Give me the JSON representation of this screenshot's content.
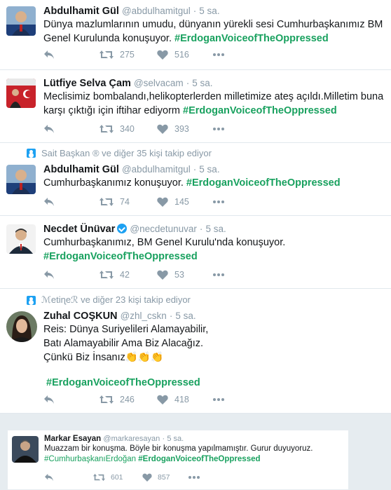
{
  "tweets": [
    {
      "name": "Abdulhamit Gül",
      "handle": "@abdulhamitgul",
      "sep": "·",
      "time": "5 sa.",
      "text": "Dünya mazlumlarının umudu, dünyanın yürekli sesi Cumhurbaşkanımız BM Genel Kurulunda konuşuyor.",
      "hashtag": "#ErdoganVoiceofTheOppressed",
      "retweets": "275",
      "likes": "516"
    },
    {
      "name": "Lütfiye Selva Çam",
      "handle": "@selvacam",
      "sep": "·",
      "time": "5 sa.",
      "text": "Meclisimiz bombalandı,helikopterlerden milletimize ateş açıldı.Milletim buna karşı çıktığı için iftihar ediyorm",
      "hashtag": "#ErdoganVoiceofTheOppressed",
      "retweets": "340",
      "likes": "393"
    },
    {
      "social": "Sait Başkan ® ve diğer 35 kişi takip ediyor",
      "name": "Abdulhamit Gül",
      "handle": "@abdulhamitgul",
      "sep": "·",
      "time": "5 sa.",
      "text": "Cumhurbaşkanımız konuşuyor.",
      "hashtag": "#ErdoganVoiceofTheOppressed",
      "retweets": "74",
      "likes": "145"
    },
    {
      "name": "Necdet Ünüvar",
      "handle": "@necdetunuvar",
      "sep": "·",
      "time": "5 sa.",
      "text": "Cumhurbaşkanımız, BM Genel Kurulu'nda konuşuyor.",
      "hashtag": "#ErdoganVoiceofTheOppressed",
      "retweets": "42",
      "likes": "53"
    },
    {
      "social": "ℳetiɳeℛ ve diğer 23 kişi takip ediyor",
      "name": "Zuhal COŞKUN",
      "handle": "@zhl_cskn",
      "sep": "·",
      "time": "5 sa.",
      "line1": "Reis: Dünya Suriyelileri Alamayabilir,",
      "line2": "Batı Alamayabilir Ama Biz Alacağız.",
      "line3": "Çünkü Biz İnsanız",
      "emoji": "👏👏👏",
      "hashtag": "#ErdoganVoiceofTheOppressed",
      "retweets": "246",
      "likes": "418"
    }
  ],
  "last": {
    "name": "Markar Esayan",
    "handle": "@markaresayan",
    "sep": "·",
    "time": "5 sa.",
    "text": "Muazzam bir konuşma. Böyle bir konuşma yapılmamıştır. Gurur duyuyoruz.",
    "hashtag1": "#CumhurbaşkanıErdoğan",
    "hashtag2": "#ErdoganVoiceofTheOppressed",
    "retweets": "601",
    "likes": "857"
  },
  "colors": {
    "hashtag": "#19a15f",
    "meta": "#8899a6",
    "bg": "#e6ecf0"
  },
  "icons": [
    "reply-icon",
    "retweet-icon",
    "like-icon",
    "more-icon",
    "verified-icon",
    "follow-icon"
  ]
}
